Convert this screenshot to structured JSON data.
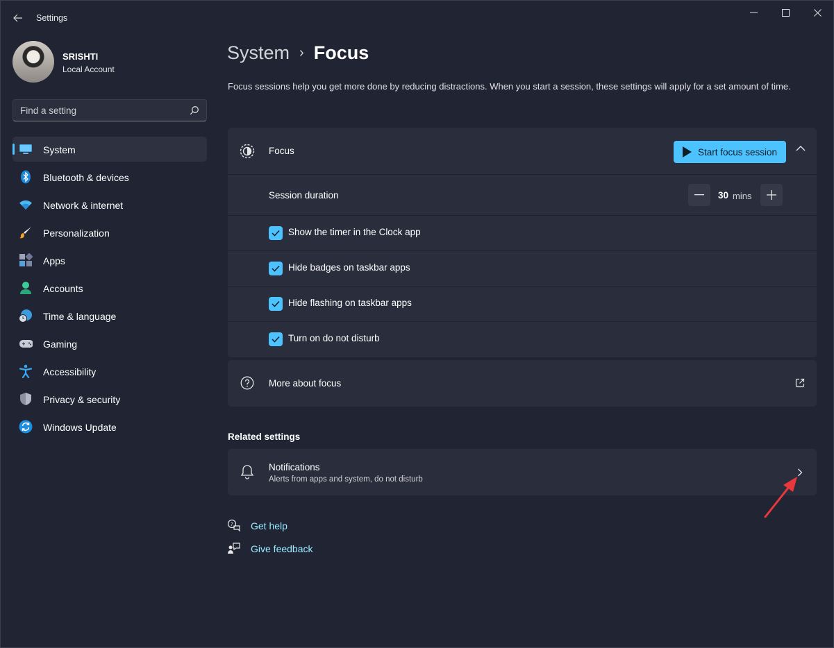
{
  "window": {
    "title": "Settings"
  },
  "user": {
    "name": "SRISHTI",
    "account_type": "Local Account"
  },
  "search": {
    "placeholder": "Find a setting"
  },
  "nav": {
    "items": [
      {
        "label": "System",
        "icon": "system-icon",
        "active": true
      },
      {
        "label": "Bluetooth & devices",
        "icon": "bluetooth-icon"
      },
      {
        "label": "Network & internet",
        "icon": "wifi-icon"
      },
      {
        "label": "Personalization",
        "icon": "brush-icon"
      },
      {
        "label": "Apps",
        "icon": "apps-icon"
      },
      {
        "label": "Accounts",
        "icon": "account-icon"
      },
      {
        "label": "Time & language",
        "icon": "globe-clock-icon"
      },
      {
        "label": "Gaming",
        "icon": "gamepad-icon"
      },
      {
        "label": "Accessibility",
        "icon": "accessibility-icon"
      },
      {
        "label": "Privacy & security",
        "icon": "shield-icon"
      },
      {
        "label": "Windows Update",
        "icon": "update-icon"
      }
    ]
  },
  "breadcrumb": {
    "parent": "System",
    "separator": "›",
    "current": "Focus"
  },
  "description": "Focus sessions help you get more done by reducing distractions. When you start a session, these settings will apply for a set amount of time.",
  "focus_card": {
    "title": "Focus",
    "start_button": "Start focus session",
    "session_duration": {
      "label": "Session duration",
      "value": "30",
      "unit": "mins"
    },
    "options": [
      {
        "label": "Show the timer in the Clock app",
        "checked": true
      },
      {
        "label": "Hide badges on taskbar apps",
        "checked": true
      },
      {
        "label": "Hide flashing on taskbar apps",
        "checked": true
      },
      {
        "label": "Turn on do not disturb",
        "checked": true
      }
    ]
  },
  "more_about": {
    "label": "More about focus"
  },
  "related": {
    "title": "Related settings",
    "notifications": {
      "title": "Notifications",
      "subtitle": "Alerts from apps and system, do not disturb"
    }
  },
  "links": {
    "help": "Get help",
    "feedback": "Give feedback"
  },
  "colors": {
    "accent": "#4cc2ff",
    "background": "#202433",
    "card": "#2a2e3c",
    "annotation_arrow": "#e8383d"
  }
}
